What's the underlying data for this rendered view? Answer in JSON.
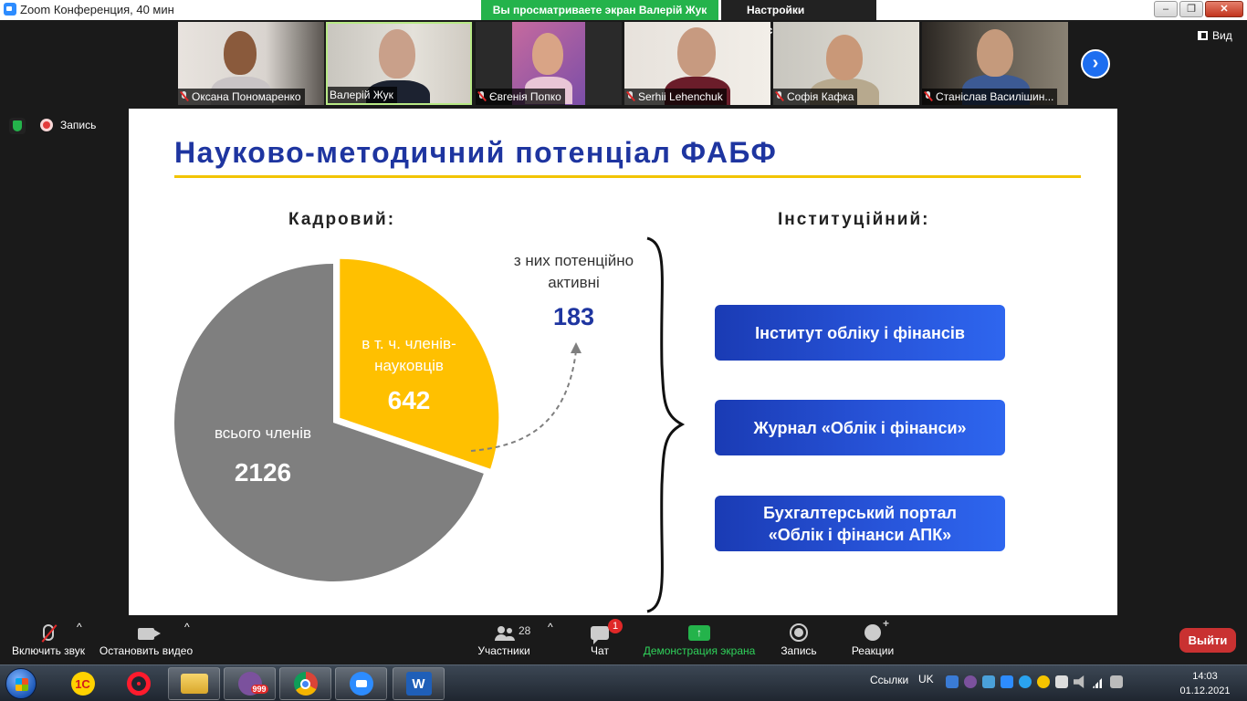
{
  "window": {
    "title": "Zoom Конференция, 40 мин",
    "share_banner": "Вы просматриваете экран Валерій Жук",
    "view_settings": "Настройки просмотра",
    "buttons": [
      "‒",
      "❐",
      "✕"
    ]
  },
  "participants": [
    {
      "name": "Оксана Пономаренко",
      "muted": true,
      "active": false
    },
    {
      "name": "Валерій Жук",
      "muted": false,
      "active": true
    },
    {
      "name": "Євгенія Попко",
      "muted": true,
      "active": false
    },
    {
      "name": "Serhii Lehenchuk",
      "muted": true,
      "active": false
    },
    {
      "name": "Софія Кафка",
      "muted": true,
      "active": false
    },
    {
      "name": "Станіслав Василішин...",
      "muted": true,
      "active": false
    }
  ],
  "view_button": "Вид",
  "recording_label": "Запись",
  "slide": {
    "title": "Науково-методичний потенціал ФАБФ",
    "left_heading": "Кадровий:",
    "right_heading": "Інституційний:",
    "pie": {
      "total_label": "всього членів",
      "total_value": "2126",
      "part_label_line1": "в т. ч. членів-",
      "part_label_line2": "науковців",
      "part_value": "642"
    },
    "note_label": "з них потенційно активні",
    "note_value": "183",
    "institutions": [
      "Інститут обліку і фінансів",
      "Журнал «Облік і фінанси»",
      "Бухгалтерський портал «Облік і фінанси АПК»"
    ],
    "colors": {
      "accent_blue": "#1e35a0",
      "gold": "#ffc000",
      "gray": "#7f7f7f"
    }
  },
  "chart_data": {
    "type": "pie",
    "categories": [
      "всього членів",
      "в т. ч. членів-науковців"
    ],
    "values": [
      2126,
      642
    ],
    "annotation": {
      "label": "з них потенційно активні",
      "value": 183
    }
  },
  "toolbar": {
    "unmute": "Включить звук",
    "stop_video": "Остановить видео",
    "participants": "Участники",
    "participants_count": "28",
    "chat": "Чат",
    "chat_badge": "1",
    "share": "Демонстрация экрана",
    "record": "Запись",
    "reactions": "Реакции",
    "leave": "Выйти"
  },
  "taskbar": {
    "apps": [
      "1C",
      "Opera",
      "Explorer",
      "Viber",
      "Chrome",
      "Zoom",
      "Word"
    ],
    "viber_badge": "999",
    "links": "Ссылки",
    "lang": "UK",
    "time": "14:03",
    "date": "01.12.2021"
  }
}
